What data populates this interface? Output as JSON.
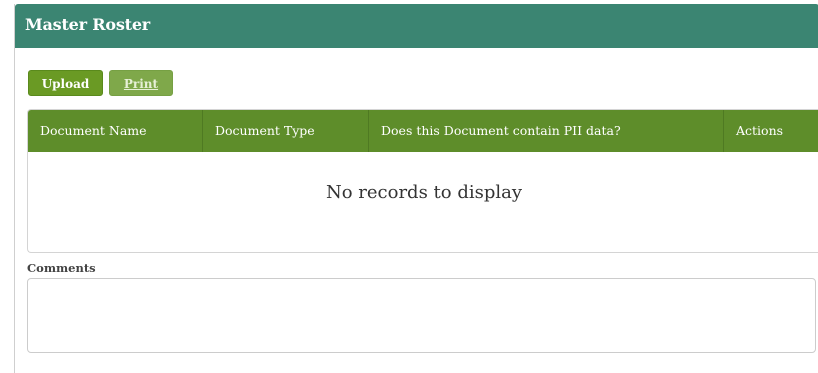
{
  "panel": {
    "title": "Master Roster"
  },
  "toolbar": {
    "upload_label": "Upload",
    "print_label": "Print"
  },
  "grid": {
    "columns": [
      "Document Name",
      "Document Type",
      "Does this Document contain PII data?",
      "Actions"
    ],
    "rows": [],
    "empty_message": "No records to display"
  },
  "comments": {
    "label": "Comments",
    "value": ""
  },
  "colors": {
    "header_bg": "#3b8572",
    "grid_header_bg": "#5e8d2a",
    "button_bg": "#6a9a24"
  }
}
